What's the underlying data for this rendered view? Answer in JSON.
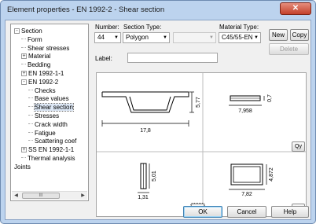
{
  "window": {
    "title": "Element properties - EN 1992-2 - Shear section"
  },
  "tree": {
    "items": [
      {
        "label": "Section",
        "expander": "-",
        "indent": 0
      },
      {
        "label": "Form",
        "expander": "",
        "indent": 1
      },
      {
        "label": "Shear stresses",
        "expander": "",
        "indent": 1
      },
      {
        "label": "Material",
        "expander": "+",
        "indent": 1
      },
      {
        "label": "Bedding",
        "expander": "",
        "indent": 1
      },
      {
        "label": "EN 1992-1-1",
        "expander": "+",
        "indent": 1
      },
      {
        "label": "EN 1992-2",
        "expander": "-",
        "indent": 1
      },
      {
        "label": "Checks",
        "expander": "",
        "indent": 2
      },
      {
        "label": "Base values",
        "expander": "",
        "indent": 2
      },
      {
        "label": "Shear section",
        "expander": "",
        "indent": 2,
        "selected": true
      },
      {
        "label": "Stresses",
        "expander": "",
        "indent": 2
      },
      {
        "label": "Crack width",
        "expander": "",
        "indent": 2
      },
      {
        "label": "Fatigue",
        "expander": "",
        "indent": 2
      },
      {
        "label": "Scattering coef",
        "expander": "",
        "indent": 2
      },
      {
        "label": "SS EN 1992-1-1",
        "expander": "+",
        "indent": 1
      },
      {
        "label": "Thermal analysis",
        "expander": "",
        "indent": 1
      },
      {
        "label": "Joints",
        "expander": "",
        "indent": 0
      }
    ],
    "scroll_thumb": "III"
  },
  "form": {
    "number_label": "Number:",
    "number_value": "44",
    "section_type_label": "Section Type:",
    "section_type_value": "Polygon",
    "section_type_sub_value": "",
    "material_type_label": "Material Type:",
    "material_type_value": "C45/55-EN",
    "label_label": "Label:",
    "label_value": "",
    "new_button": "New",
    "copy_button": "Copy",
    "delete_button": "Delete"
  },
  "views": {
    "main": {
      "width": "17,8",
      "height": "5,77"
    },
    "qy": {
      "width": "7,958",
      "height": "0,7",
      "button": "Qy"
    },
    "qz": {
      "width": "1,31",
      "height": "5,01",
      "button": "Qz"
    },
    "mx": {
      "width": "7,82",
      "height": "4,872",
      "button": "Mx"
    }
  },
  "footer": {
    "ok": "OK",
    "cancel": "Cancel",
    "help": "Help"
  }
}
